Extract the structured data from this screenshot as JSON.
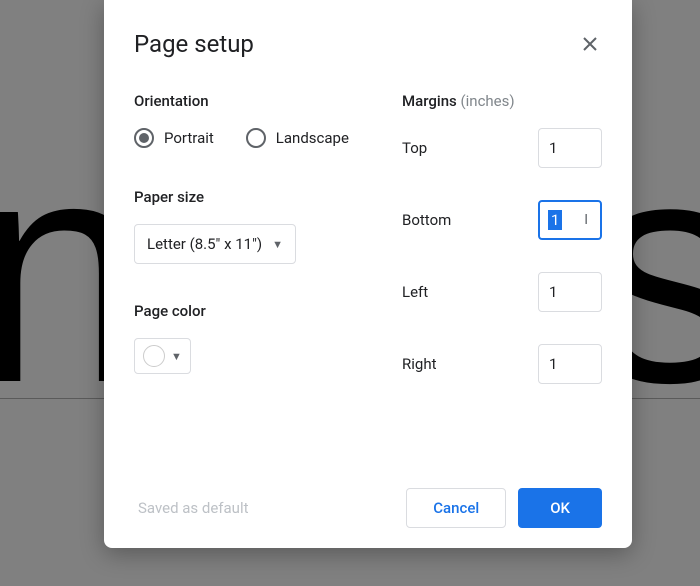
{
  "dialog": {
    "title": "Page setup",
    "orientation": {
      "label": "Orientation",
      "portrait": "Portrait",
      "landscape": "Landscape",
      "selected": "portrait"
    },
    "paper_size": {
      "label": "Paper size",
      "value": "Letter (8.5\" x 11\")"
    },
    "page_color": {
      "label": "Page color",
      "value": "#ffffff"
    },
    "margins": {
      "label": "Margins",
      "unit": "(inches)",
      "top": {
        "label": "Top",
        "value": "1"
      },
      "bottom": {
        "label": "Bottom",
        "value": "1"
      },
      "left": {
        "label": "Left",
        "value": "1"
      },
      "right": {
        "label": "Right",
        "value": "1"
      }
    },
    "footer": {
      "saved_default": "Saved as default",
      "cancel": "Cancel",
      "ok": "OK"
    }
  }
}
